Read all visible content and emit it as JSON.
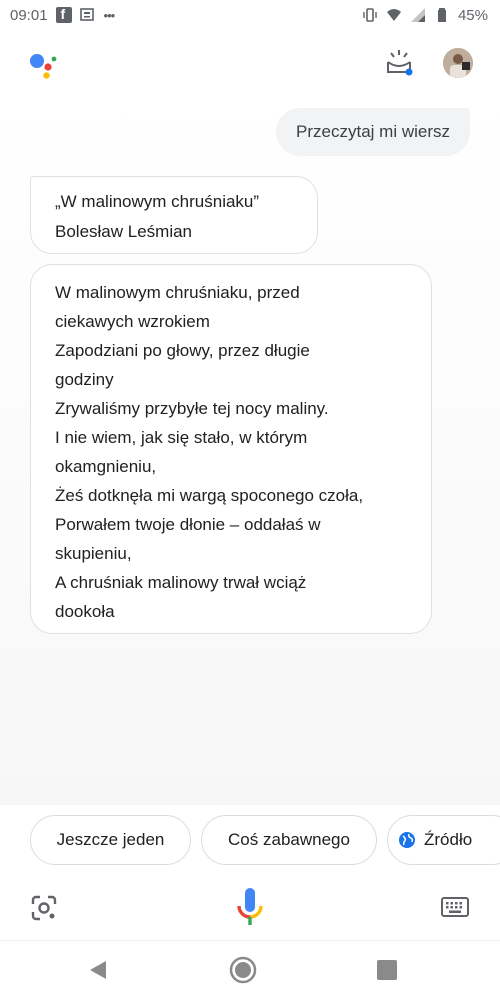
{
  "status_bar": {
    "time": "09:01",
    "battery": "45%"
  },
  "conversation": {
    "user_query": "Przeczytaj mi wiersz",
    "title_card": {
      "title": "„W malinowym chruśniaku”",
      "author": "Bolesław Leśmian"
    },
    "poem_lines": [
      "W malinowym chruśniaku, przed",
      "ciekawych wzrokiem",
      "Zapodziani po głowy, przez długie",
      "godziny",
      "Zrywaliśmy przybyłe tej nocy maliny.",
      "I nie wiem, jak się stało, w którym",
      "okamgnieniu,",
      "Żeś dotknęła mi wargą spoconego czoła,",
      "Porwałem twoje dłonie – oddałaś w",
      "skupieniu,",
      "A chruśniak malinowy trwał wciąż",
      "dookoła"
    ]
  },
  "suggestions": [
    {
      "label": "Jeszcze jeden"
    },
    {
      "label": "Coś zabawnego"
    },
    {
      "label": "Źródło",
      "icon": "globe-icon"
    }
  ],
  "colors": {
    "google_blue": "#4285F4",
    "google_red": "#EA4335",
    "google_yellow": "#FBBC05",
    "google_green": "#34A853"
  }
}
